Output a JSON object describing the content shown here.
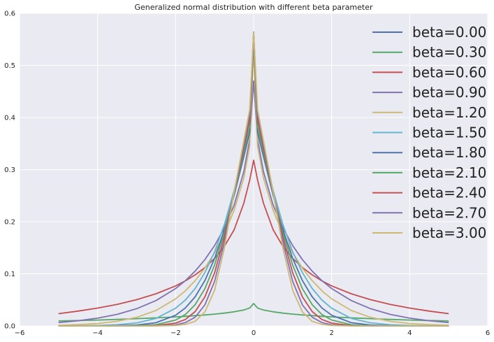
{
  "chart_data": {
    "type": "line",
    "title": "Generalized normal distribution with different beta parameter",
    "xlabel": "",
    "ylabel": "",
    "xlim": [
      -6,
      6
    ],
    "ylim": [
      0,
      0.6
    ],
    "x_ticks": [
      "−6",
      "−4",
      "−2",
      "0",
      "2",
      "4",
      "6"
    ],
    "y_ticks": [
      "0.0",
      "0.1",
      "0.2",
      "0.3",
      "0.4",
      "0.5",
      "0.6"
    ],
    "x_tick_values": [
      -6,
      -4,
      -2,
      0,
      2,
      4,
      6
    ],
    "y_tick_values": [
      0,
      0.1,
      0.2,
      0.3,
      0.4,
      0.5,
      0.6
    ],
    "grid": true,
    "background": "#eaeaf2",
    "legend_position": "upper-right",
    "x": [
      -5,
      -4.5,
      -4,
      -3.5,
      -3,
      -2.5,
      -2,
      -1.75,
      -1.5,
      -1.25,
      -1,
      -0.75,
      -0.5,
      -0.25,
      -0.1,
      0,
      0.1,
      0.25,
      0.5,
      0.75,
      1,
      1.25,
      1.5,
      1.75,
      2,
      2.5,
      3,
      3.5,
      4,
      4.5,
      5
    ],
    "series": [
      {
        "name": "beta=0.00",
        "color": "#4c72b0",
        "values": [
          null,
          null,
          null,
          null,
          null,
          null,
          null,
          null,
          null,
          null,
          null,
          null,
          null,
          null,
          null,
          null,
          null,
          null,
          null,
          null,
          null,
          null,
          null,
          null,
          null,
          null,
          null,
          null,
          null,
          null,
          null
        ]
      },
      {
        "name": "beta=0.30",
        "color": "#55a868",
        "values": [
          0.0095,
          0.0104,
          0.0113,
          0.0125,
          0.0139,
          0.0154,
          0.0173,
          0.0184,
          0.0197,
          0.0211,
          0.0227,
          0.0246,
          0.0271,
          0.0305,
          0.0345,
          0.043,
          0.0345,
          0.0305,
          0.0271,
          0.0246,
          0.0227,
          0.0211,
          0.0197,
          0.0184,
          0.0173,
          0.0154,
          0.0139,
          0.0125,
          0.0113,
          0.0104,
          0.0095
        ]
      },
      {
        "name": "beta=0.60",
        "color": "#c44e52",
        "values": [
          0.0235,
          0.0284,
          0.0342,
          0.0413,
          0.0503,
          0.0618,
          0.0768,
          0.0864,
          0.098,
          0.112,
          0.1297,
          0.1526,
          0.1846,
          0.2357,
          0.2801,
          0.318,
          0.2801,
          0.2357,
          0.1846,
          0.1526,
          0.1297,
          0.112,
          0.098,
          0.0864,
          0.0768,
          0.0618,
          0.0503,
          0.0413,
          0.0342,
          0.0284,
          0.0235
        ]
      },
      {
        "name": "beta=0.90",
        "color": "#8172b2",
        "values": [
          0.0065,
          0.0099,
          0.0149,
          0.0222,
          0.033,
          0.0487,
          0.0717,
          0.0868,
          0.1051,
          0.1273,
          0.1543,
          0.1881,
          0.2317,
          0.2962,
          0.3584,
          0.47,
          0.3584,
          0.2962,
          0.2317,
          0.1881,
          0.1543,
          0.1273,
          0.1051,
          0.0868,
          0.0717,
          0.0487,
          0.033,
          0.0222,
          0.0149,
          0.0099,
          0.0065
        ]
      },
      {
        "name": "beta=1.20",
        "color": "#ccb974",
        "values": [
          0.0012,
          0.0024,
          0.0046,
          0.0088,
          0.0164,
          0.0296,
          0.0519,
          0.0674,
          0.0868,
          0.1109,
          0.1404,
          0.1765,
          0.2219,
          0.2842,
          0.3461,
          0.53,
          0.3461,
          0.2842,
          0.2219,
          0.1765,
          0.1404,
          0.1109,
          0.0868,
          0.0674,
          0.0519,
          0.0296,
          0.0164,
          0.0088,
          0.0046,
          0.0024,
          0.0012
        ]
      },
      {
        "name": "beta=1.50",
        "color": "#64b5cd",
        "values": [
          0.0001,
          0.0003,
          0.0008,
          0.0022,
          0.0058,
          0.0145,
          0.0339,
          0.0497,
          0.0718,
          0.1021,
          0.1424,
          0.1946,
          0.2601,
          0.339,
          0.3981,
          0.548,
          0.3981,
          0.339,
          0.2601,
          0.1946,
          0.1424,
          0.1021,
          0.0718,
          0.0497,
          0.0339,
          0.0145,
          0.0058,
          0.0022,
          0.0008,
          0.0003,
          0.0001
        ]
      },
      {
        "name": "beta=1.80",
        "color": "#4c72b0",
        "values": [
          0,
          0,
          0.0001,
          0.0004,
          0.0016,
          0.0062,
          0.0205,
          0.0345,
          0.0559,
          0.087,
          0.1296,
          0.1845,
          0.2507,
          0.3254,
          0.3712,
          0.556,
          0.3712,
          0.3254,
          0.2507,
          0.1845,
          0.1296,
          0.087,
          0.0559,
          0.0345,
          0.0205,
          0.0062,
          0.0016,
          0.0004,
          0.0001,
          0,
          0
        ]
      },
      {
        "name": "beta=2.10",
        "color": "#55a868",
        "values": [
          0,
          0,
          0,
          0,
          0.0003,
          0.0023,
          0.0113,
          0.0219,
          0.0408,
          0.0714,
          0.1171,
          0.1788,
          0.2536,
          0.3339,
          0.3824,
          0.56,
          0.3824,
          0.3339,
          0.2536,
          0.1788,
          0.1171,
          0.0714,
          0.0408,
          0.0219,
          0.0113,
          0.0023,
          0.0003,
          0,
          0,
          0,
          0
        ]
      },
      {
        "name": "beta=2.40",
        "color": "#c44e52",
        "values": [
          0,
          0,
          0,
          0,
          0,
          0.0007,
          0.0054,
          0.0124,
          0.0275,
          0.0557,
          0.1022,
          0.1707,
          0.2555,
          0.3423,
          0.3959,
          0.562,
          0.3959,
          0.3423,
          0.2555,
          0.1707,
          0.1022,
          0.0557,
          0.0275,
          0.0124,
          0.0054,
          0.0007,
          0,
          0,
          0,
          0,
          0
        ]
      },
      {
        "name": "beta=2.70",
        "color": "#8172b2",
        "values": [
          0,
          0,
          0,
          0,
          0,
          0.0002,
          0.0022,
          0.0064,
          0.0166,
          0.0403,
          0.0858,
          0.1608,
          0.2564,
          0.3497,
          0.4077,
          0.564,
          0.4077,
          0.3497,
          0.2564,
          0.1608,
          0.0858,
          0.0403,
          0.0166,
          0.0064,
          0.0022,
          0.0002,
          0,
          0,
          0,
          0,
          0
        ]
      },
      {
        "name": "beta=3.00",
        "color": "#ccb974",
        "values": [
          0,
          0,
          0,
          0,
          0,
          0,
          0.0008,
          0.0029,
          0.0089,
          0.0269,
          0.0687,
          0.1496,
          0.2573,
          0.3556,
          0.4158,
          0.563,
          0.4158,
          0.3556,
          0.2573,
          0.1496,
          0.0687,
          0.0269,
          0.0089,
          0.0029,
          0.0008,
          0,
          0,
          0,
          0,
          0,
          0
        ]
      }
    ]
  }
}
